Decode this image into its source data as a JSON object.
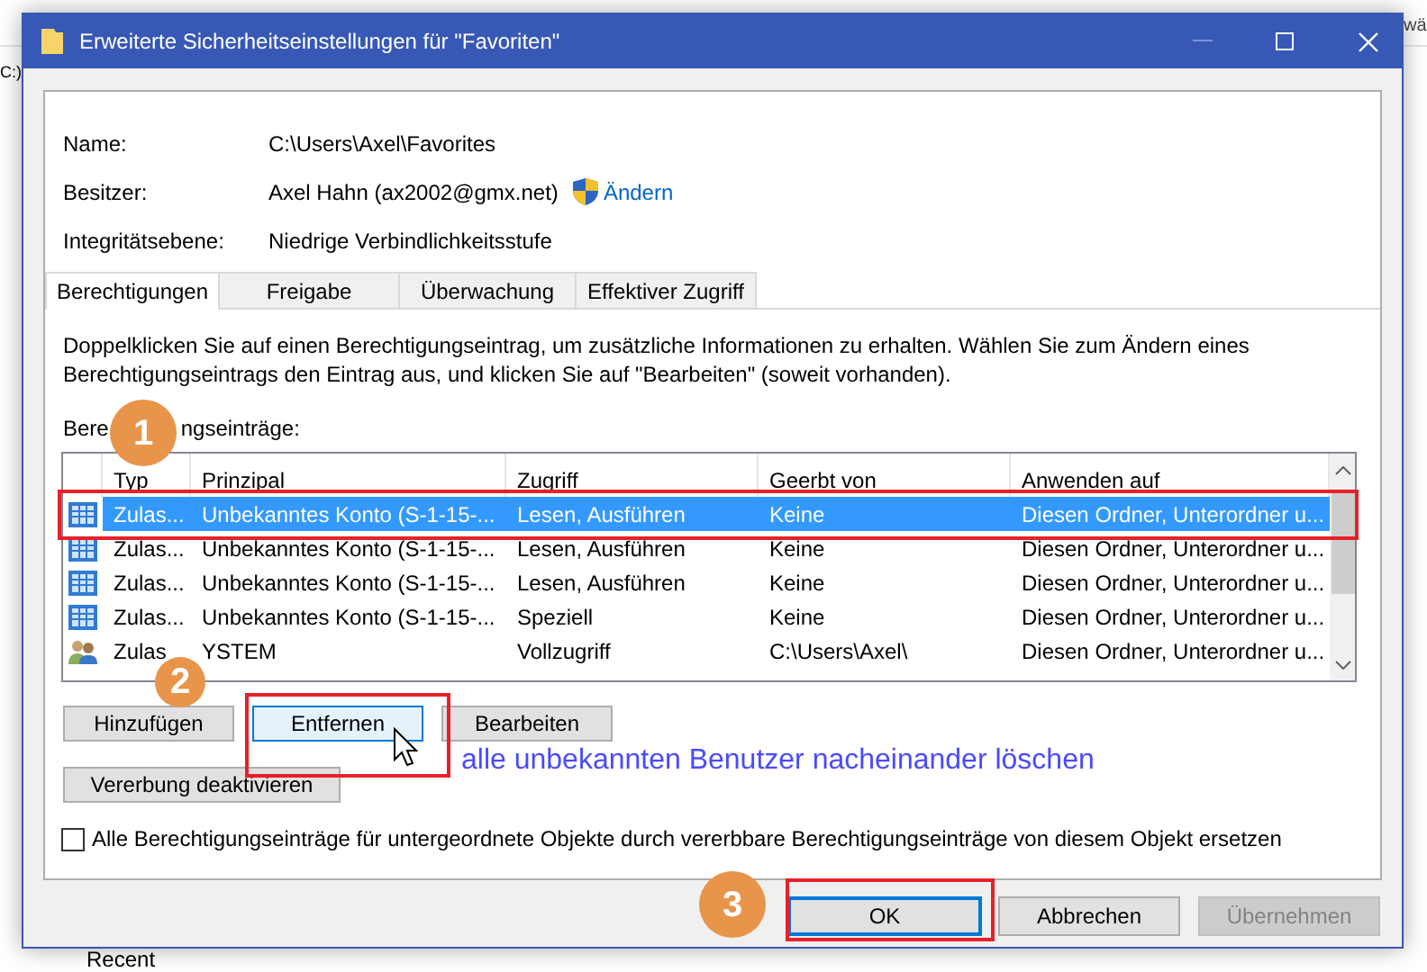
{
  "background": {
    "drive_label": "C:)",
    "column_fragment": "wä",
    "tree_item": "Recent"
  },
  "window": {
    "title": "Erweiterte Sicherheitseinstellungen für \"Favoriten\""
  },
  "info": [
    {
      "label": "Name:",
      "value": "C:\\Users\\Axel\\Favorites"
    },
    {
      "label": "Besitzer:",
      "value": "Axel Hahn (ax2002@gmx.net)",
      "link": "Ändern"
    },
    {
      "label": "Integritätsebene:",
      "value": "Niedrige Verbindlichkeitsstufe"
    }
  ],
  "tabs": [
    {
      "label": "Berechtigungen",
      "selected": true
    },
    {
      "label": "Freigabe",
      "selected": false
    },
    {
      "label": "Überwachung",
      "selected": false
    },
    {
      "label": "Effektiver Zugriff",
      "selected": false
    }
  ],
  "description": "Doppelklicken Sie auf einen Berechtigungseintrag, um zusätzliche Informationen zu erhalten. Wählen Sie zum Ändern eines Berechtigungseintrags den Eintrag aus, und klicken Sie auf \"Bearbeiten\" (soweit vorhanden).",
  "list_label": [
    "Bere",
    "ngseinträge:"
  ],
  "permissions": {
    "columns": [
      "Typ",
      "Prinzipal",
      "Zugriff",
      "Geerbt von",
      "Anwenden auf"
    ],
    "rows": [
      {
        "kind": "app",
        "selected": true,
        "cells": [
          "Zulas...",
          "Unbekanntes Konto (S-1-15-...",
          "Lesen, Ausführen",
          "Keine",
          "Diesen Ordner, Unterordner u..."
        ]
      },
      {
        "kind": "app",
        "selected": false,
        "cells": [
          "Zulas...",
          "Unbekanntes Konto (S-1-15-...",
          "Lesen, Ausführen",
          "Keine",
          "Diesen Ordner, Unterordner u..."
        ]
      },
      {
        "kind": "app",
        "selected": false,
        "cells": [
          "Zulas...",
          "Unbekanntes Konto (S-1-15-...",
          "Lesen, Ausführen",
          "Keine",
          "Diesen Ordner, Unterordner u..."
        ]
      },
      {
        "kind": "app",
        "selected": false,
        "cells": [
          "Zulas...",
          "Unbekanntes Konto (S-1-15-...",
          "Speziell",
          "Keine",
          "Diesen Ordner, Unterordner u..."
        ]
      },
      {
        "kind": "user",
        "selected": false,
        "cells": [
          "Zulas",
          "YSTEM",
          "Vollzugriff",
          "C:\\Users\\Axel\\",
          "Diesen Ordner, Unterordner u..."
        ]
      }
    ]
  },
  "buttons": [
    {
      "label": "Hinzufügen",
      "hovered": false
    },
    {
      "label": "Entfernen",
      "hovered": true
    },
    {
      "label": "Bearbeiten",
      "hovered": false
    }
  ],
  "inheritance_button": "Vererbung deaktivieren",
  "replace_checkbox": {
    "label": "Alle Berechtigungseinträge für untergeordnete Objekte durch vererbbare Berechtigungseinträge von diesem Objekt ersetzen",
    "checked": false
  },
  "dialog_buttons": [
    {
      "label": "OK",
      "focused": true,
      "disabled": false
    },
    {
      "label": "Abbrechen",
      "focused": false,
      "disabled": false
    },
    {
      "label": "Übernehmen",
      "focused": false,
      "disabled": true
    }
  ],
  "annotations": {
    "markers": [
      "1",
      "2",
      "3"
    ],
    "note": "alle unbekannten Benutzer nacheinander löschen"
  }
}
